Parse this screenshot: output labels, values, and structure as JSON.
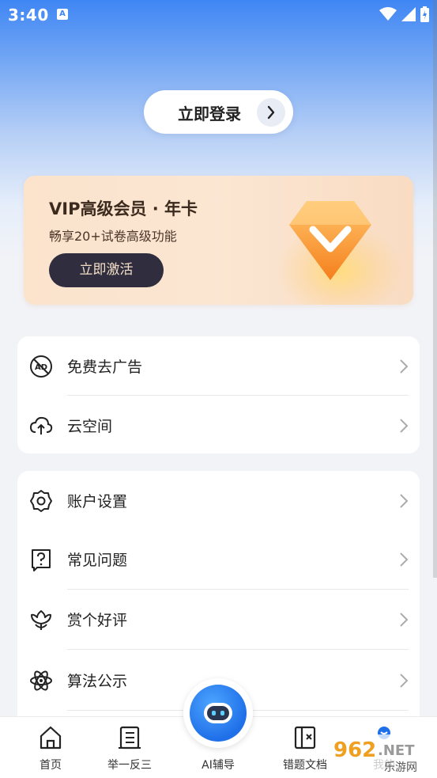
{
  "status": {
    "time": "3:40",
    "notification_badge": "A"
  },
  "login": {
    "label": "立即登录"
  },
  "vip": {
    "title": "VIP高级会员 · 年卡",
    "subtitle": "畅享20+试卷高级功能",
    "button": "立即激活"
  },
  "menu_group1": [
    {
      "label": "免费去广告",
      "icon": "no-ad-icon"
    },
    {
      "label": "云空间",
      "icon": "cloud-upload-icon"
    }
  ],
  "menu_group2": [
    {
      "label": "账户设置",
      "icon": "gear-icon"
    },
    {
      "label": "常见问题",
      "icon": "question-icon"
    },
    {
      "label": "赏个好评",
      "icon": "flower-icon"
    },
    {
      "label": "算法公示",
      "icon": "atom-icon"
    }
  ],
  "tabs": [
    {
      "label": "首页",
      "icon": "home-icon"
    },
    {
      "label": "举一反三",
      "icon": "list-icon"
    },
    {
      "label": "AI辅导",
      "icon": "robot-icon"
    },
    {
      "label": "错题文档",
      "icon": "error-doc-icon"
    },
    {
      "label": "我的",
      "icon": "profile-icon"
    }
  ],
  "watermark": {
    "text_top": "962",
    "text_tld": ".NET",
    "text_bottom": "乐游网"
  },
  "colors": {
    "accent": "#1f6fe8",
    "vip_button": "#2f2d3e",
    "gem": "#f7a13a"
  }
}
